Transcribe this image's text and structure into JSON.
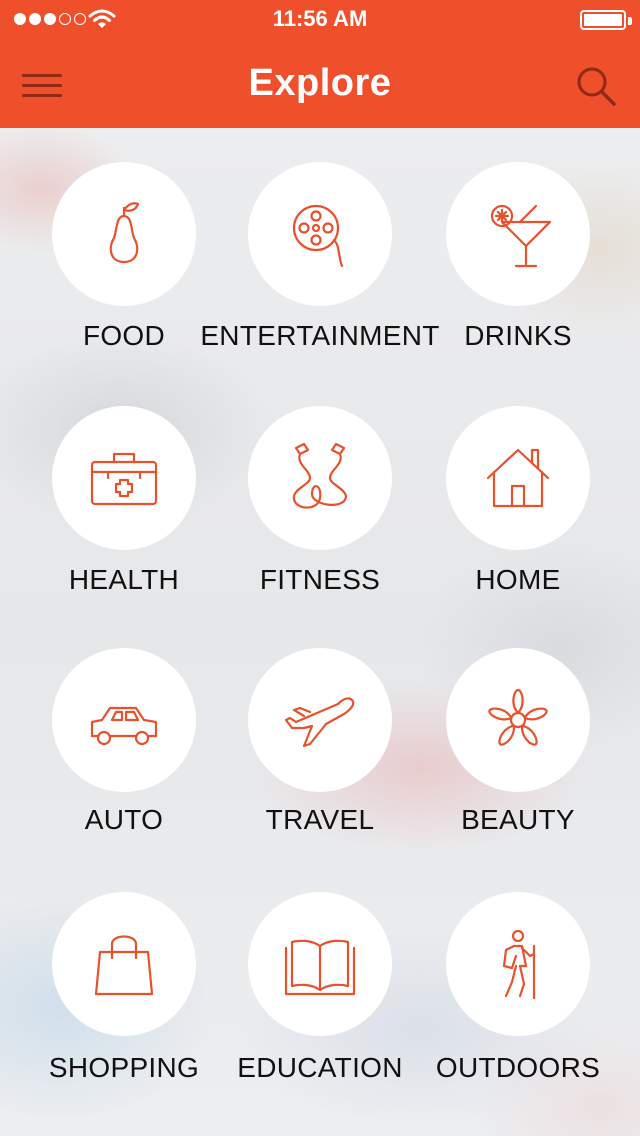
{
  "status_bar": {
    "time": "11:56 AM",
    "signal_bars_filled": 3,
    "signal_bars_total": 5
  },
  "nav": {
    "title": "Explore",
    "menu_icon": "hamburger-menu-icon",
    "search_icon": "search-icon"
  },
  "colors": {
    "brand": "#ef4f2b",
    "icon_stroke": "#e8512c",
    "label": "#111111"
  },
  "categories": [
    {
      "label": "FOOD",
      "icon": "pear-icon"
    },
    {
      "label": "ENTERTAINMENT",
      "icon": "film-reel-icon"
    },
    {
      "label": "DRINKS",
      "icon": "cocktail-icon"
    },
    {
      "label": "HEALTH",
      "icon": "first-aid-kit-icon"
    },
    {
      "label": "FITNESS",
      "icon": "jump-rope-icon"
    },
    {
      "label": "HOME",
      "icon": "house-icon"
    },
    {
      "label": "AUTO",
      "icon": "car-icon"
    },
    {
      "label": "TRAVEL",
      "icon": "airplane-icon"
    },
    {
      "label": "BEAUTY",
      "icon": "flower-icon"
    },
    {
      "label": "SHOPPING",
      "icon": "shopping-bag-icon"
    },
    {
      "label": "EDUCATION",
      "icon": "open-book-icon"
    },
    {
      "label": "OUTDOORS",
      "icon": "hiker-icon"
    }
  ]
}
